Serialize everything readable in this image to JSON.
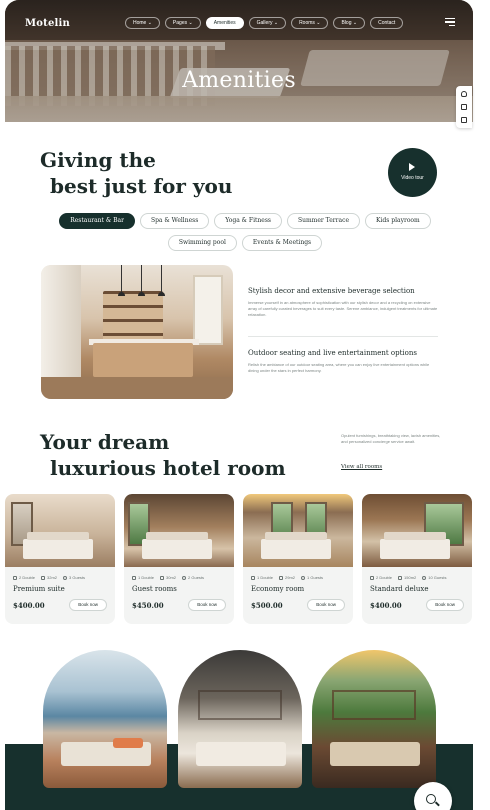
{
  "brand": {
    "logo": "Motelin"
  },
  "nav": {
    "items": [
      {
        "label": "Home ⌄",
        "active": false
      },
      {
        "label": "Pages ⌄",
        "active": false
      },
      {
        "label": "Amenities",
        "active": true
      },
      {
        "label": "Gallery ⌄",
        "active": false
      },
      {
        "label": "Rooms ⌄",
        "active": false
      },
      {
        "label": "Blog ⌄",
        "active": false
      },
      {
        "label": "Contact",
        "active": false
      }
    ]
  },
  "hero": {
    "title": "Amenities"
  },
  "side_tools": [
    "headset-icon",
    "book-icon",
    "cart-icon"
  ],
  "amenities": {
    "heading_line1": "Giving the",
    "heading_line2": "best just for you",
    "video_label": "Video tour",
    "tabs_row1": [
      "Restaurant & Bar",
      "Spa & Wellness",
      "Yoga & Fitness",
      "Summer Terrace",
      "Kids playroom"
    ],
    "tabs_row2": [
      "Swimming pool",
      "Events & Meetings"
    ],
    "active_tab": "Restaurant & Bar",
    "feature1": {
      "title": "Stylish decor and extensive beverage selection",
      "text": "Immerse yourself in an atmosphere of sophistication with our stylish decor and a recycling on extensive array of carefully curated beverages to suit every taste. Serene ambiance, indulgent treatments for ultimate relaxation."
    },
    "feature2": {
      "title": "Outdoor seating and live entertainment options",
      "text": "Relish the ambiance of our outdoor seating area, where you can enjoy live entertainment options while dining under the stars in perfect harmony."
    }
  },
  "rooms": {
    "heading_line1": "Your dream",
    "heading_line2": "luxurious hotel room",
    "description": "Opulent furnishings, breathtaking view, lavish amenities, and personalized concierge service await.",
    "view_all": "View all rooms",
    "cards": [
      {
        "beds": "2 Double",
        "area": "32m2",
        "guests": "3 Guests",
        "name": "Premium suite",
        "price": "$400.00",
        "book": "Book now"
      },
      {
        "beds": "1 Double",
        "area": "30m2",
        "guests": "2 Guests",
        "name": "Guest rooms",
        "price": "$450.00",
        "book": "Book now"
      },
      {
        "beds": "1 Double",
        "area": "29m2",
        "guests": "1 Guests",
        "name": "Economy room",
        "price": "$500.00",
        "book": "Book now"
      },
      {
        "beds": "2 Double",
        "area": "150m2",
        "guests": "10 Guests",
        "name": "Standard deluxe",
        "price": "$400.00",
        "book": "Book now"
      }
    ]
  }
}
